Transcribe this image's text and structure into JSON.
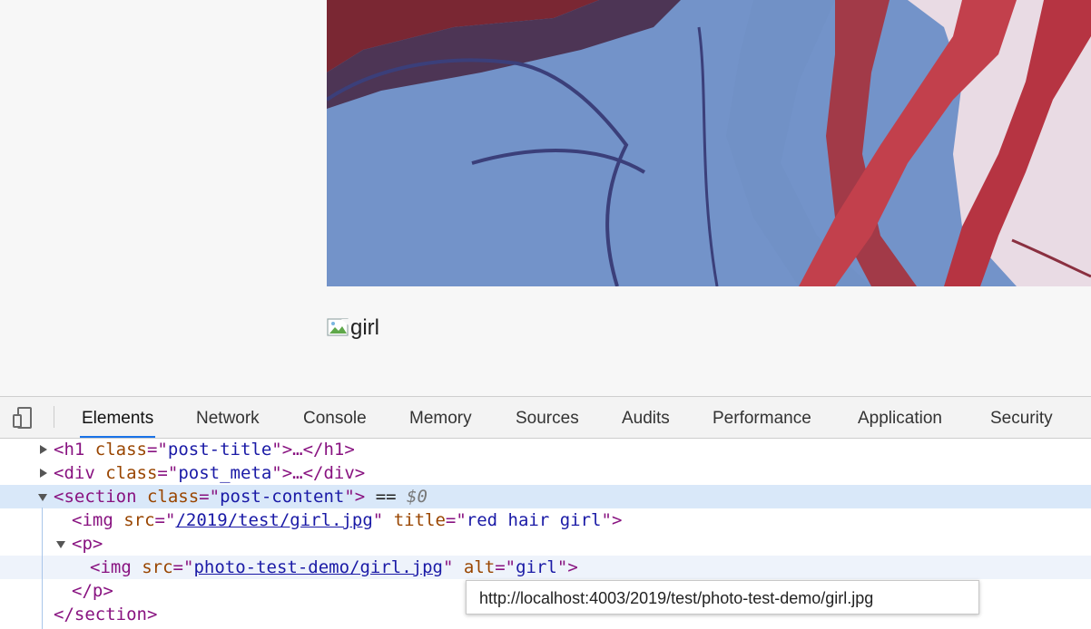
{
  "page": {
    "broken_image_alt": "girl"
  },
  "devtools": {
    "tabs": [
      {
        "label": "Elements",
        "active": true
      },
      {
        "label": "Network"
      },
      {
        "label": "Console"
      },
      {
        "label": "Memory"
      },
      {
        "label": "Sources"
      },
      {
        "label": "Audits"
      },
      {
        "label": "Performance"
      },
      {
        "label": "Application"
      },
      {
        "label": "Security"
      }
    ],
    "accent_color": "#1a73e8",
    "dom_tree": {
      "h1": {
        "open": "<h1",
        "attr": "class",
        "value": "post-title",
        "rest": ">…</h1>"
      },
      "div": {
        "open": "<div",
        "attr": "class",
        "value": "post_meta",
        "rest": ">…</div>"
      },
      "section": {
        "open": "<section",
        "attr": "class",
        "value": "post-content",
        "close": ">",
        "marker": "==",
        "ref": "$0"
      },
      "img1": {
        "open": "<img",
        "attr1": "src",
        "value1": "/2019/test/girl.jpg",
        "attr2": "title",
        "value2": "red hair girl",
        "close": ">"
      },
      "p_open": "<p>",
      "img2": {
        "open": "<img",
        "attr1": "src",
        "value1": "photo-test-demo/girl.jpg",
        "attr2": "alt",
        "value2": "girl",
        "close": ">"
      },
      "p_close": "</p>",
      "section_close": "</section>"
    },
    "tooltip": "http://localhost:4003/2019/test/photo-test-demo/girl.jpg"
  }
}
